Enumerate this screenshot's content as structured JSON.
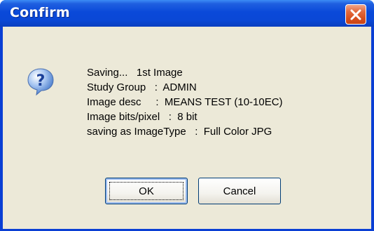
{
  "window": {
    "title": "Confirm",
    "close_icon": "close-x-icon",
    "message_icon": "question-icon"
  },
  "message": {
    "lines": [
      "Saving...   1st Image",
      "Study Group   :  ADMIN",
      "Image desc     :  MEANS TEST (10-10EC)",
      "Image bits/pixel   :  8 bit",
      "saving as ImageType   :  Full Color JPG"
    ]
  },
  "buttons": {
    "ok_label": "OK",
    "cancel_label": "Cancel"
  },
  "colors": {
    "titlebar": "#0a49d9",
    "client_bg": "#ece9d8",
    "close_button": "#d8501f",
    "button_border": "#003c74"
  }
}
